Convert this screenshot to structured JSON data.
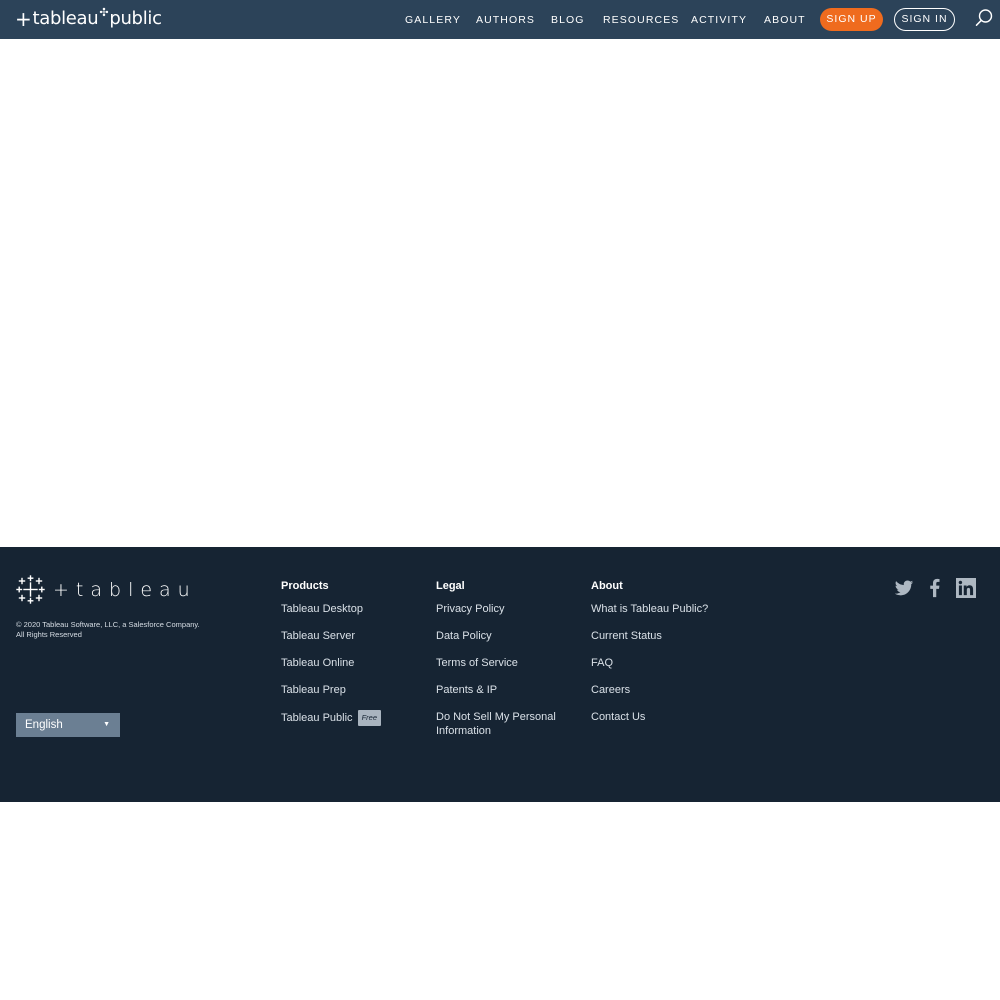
{
  "nav": {
    "logo": {
      "before": "tableau",
      "after": "public"
    },
    "links": [
      "GALLERY",
      "AUTHORS",
      "BLOG",
      "RESOURCES",
      "ACTIVITY",
      "ABOUT"
    ],
    "signup": "SIGN UP",
    "signin": "SIGN IN",
    "search_icon": "search-icon"
  },
  "footer": {
    "logo_word": "tableau",
    "copyright_line1": "© 2020 Tableau Software, LLC, a Salesforce Company.",
    "copyright_line2": "All Rights Reserved",
    "language": "English",
    "columns": [
      {
        "title": "Products",
        "links": [
          "Tableau Desktop",
          "Tableau Server",
          "Tableau Online",
          "Tableau Prep",
          "Tableau Public"
        ],
        "badge": "Free"
      },
      {
        "title": "Legal",
        "links": [
          "Privacy Policy",
          "Data Policy",
          "Terms of Service",
          "Patents & IP",
          "Do Not Sell My Personal Information"
        ]
      },
      {
        "title": "About",
        "links": [
          "What is Tableau Public?",
          "Current Status",
          "FAQ",
          "Careers",
          "Contact Us"
        ]
      }
    ],
    "social_icons": [
      "twitter-icon",
      "facebook-icon",
      "linkedin-icon"
    ]
  },
  "colors": {
    "nav_bg": "#2c4359",
    "accent": "#ef6b1e",
    "footer_bg": "#162433"
  }
}
